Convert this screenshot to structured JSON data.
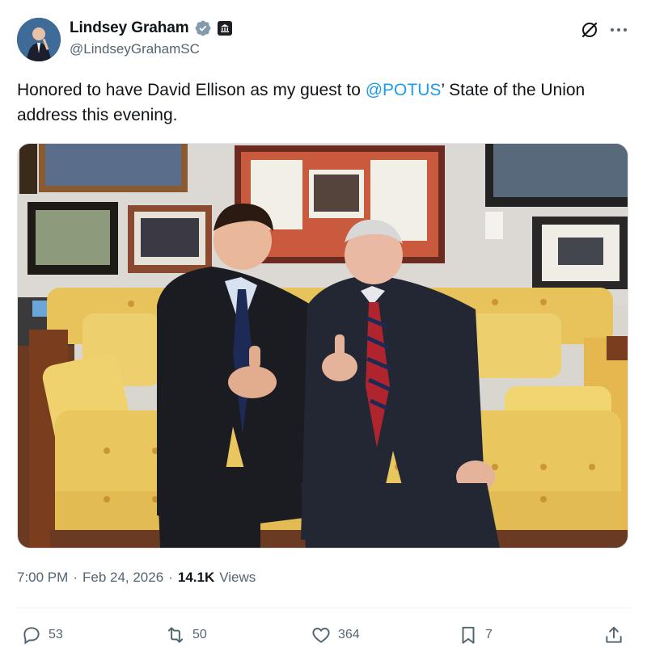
{
  "author": {
    "name": "Lindsey Graham",
    "handle": "@LindseyGrahamSC"
  },
  "tweet": {
    "text_before": "Honored to have David Ellison as my guest to ",
    "mention": "@POTUS",
    "text_after": "’ State of the Union address this evening."
  },
  "meta": {
    "time": "7:00 PM",
    "separator": "·",
    "date": "Feb 24, 2026",
    "separator2": "·",
    "views_count": "14.1K",
    "views_label": "Views"
  },
  "actions": {
    "replies": "53",
    "reposts": "50",
    "likes": "364",
    "bookmarks": "7"
  },
  "icons": {
    "verified": "verified-badge-icon",
    "government": "government-building-icon",
    "grok": "grok-icon",
    "more": "more-horizontal-icon",
    "reply": "reply-icon",
    "repost": "repost-icon",
    "like": "heart-icon",
    "bookmark": "bookmark-icon",
    "share": "share-icon"
  },
  "colors": {
    "accent": "#1d9bf0",
    "text": "#0f1419",
    "muted": "#536471"
  }
}
